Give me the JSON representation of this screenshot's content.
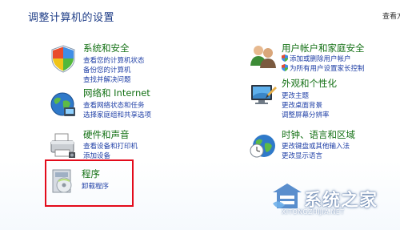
{
  "page": {
    "title": "调整计算机的设置",
    "view_by": "查看方"
  },
  "categories": {
    "system": {
      "title": "系统和安全",
      "links": [
        "查看您的计算机状态",
        "备份您的计算机",
        "查找并解决问题"
      ]
    },
    "network": {
      "title": "网络和 Internet",
      "links": [
        "查看网络状态和任务",
        "选择家庭组和共享选项"
      ]
    },
    "hardware": {
      "title": "硬件和声音",
      "links": [
        "查看设备和打印机",
        "添加设备"
      ]
    },
    "programs": {
      "title": "程序",
      "links": [
        "卸载程序"
      ]
    },
    "accounts": {
      "title": "用户帐户和家庭安全",
      "links": [
        "添加或删除用户帐户",
        "为所有用户设置家长控制"
      ]
    },
    "appearance": {
      "title": "外观和个性化",
      "links": [
        "更改主题",
        "更改桌面背景",
        "调整屏幕分辨率"
      ]
    },
    "clock": {
      "title": "时钟、语言和区域",
      "links": [
        "更改键盘或其他输入法",
        "更改显示语言"
      ]
    }
  },
  "watermark": {
    "text": "系统之家",
    "sub": "XITONGZHIJIA.NET"
  },
  "colors": {
    "title": "#1e3d87",
    "category_title": "#137014",
    "link": "#1f3fa6",
    "highlight": "#e30b1b"
  }
}
